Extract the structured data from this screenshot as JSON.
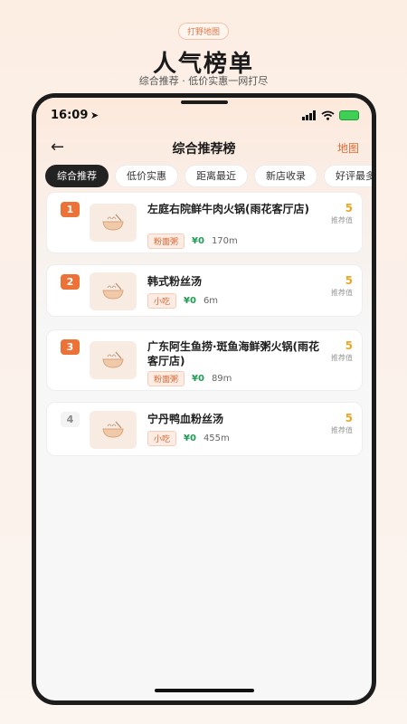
{
  "promo": {
    "tag": "打野地图",
    "title": "人气榜单",
    "subtitle": "综合推荐 · 低价实惠一网打尽"
  },
  "status_bar": {
    "time": "16:09"
  },
  "nav": {
    "title": "综合推荐榜",
    "map_label": "地图"
  },
  "tabs": [
    {
      "label": "综合推荐",
      "active": true
    },
    {
      "label": "低价实惠",
      "active": false
    },
    {
      "label": "距离最近",
      "active": false
    },
    {
      "label": "新店收录",
      "active": false
    },
    {
      "label": "好评最多",
      "active": false
    }
  ],
  "items": [
    {
      "rank": "1",
      "name": "左庭右院鲜牛肉火锅(雨花客厅店)",
      "tag": "粉面粥",
      "price": "¥0",
      "distance": "170m",
      "score": "5",
      "score_label": "推荐值"
    },
    {
      "rank": "2",
      "name": "韩式粉丝汤",
      "tag": "小吃",
      "price": "¥0",
      "distance": "6m",
      "score": "5",
      "score_label": "推荐值"
    },
    {
      "rank": "3",
      "name": "广东阿生鱼捞·斑鱼海鲜粥火锅(雨花客厅店)",
      "tag": "粉面粥",
      "price": "¥0",
      "distance": "89m",
      "score": "5",
      "score_label": "推荐值"
    },
    {
      "rank": "4",
      "name": "宁丹鸭血粉丝汤",
      "tag": "小吃",
      "price": "¥0",
      "distance": "455m",
      "score": "5",
      "score_label": "推荐值"
    }
  ],
  "colors": {
    "accent": "#ec7237",
    "score": "#e9a825",
    "price": "#1f9d55"
  }
}
